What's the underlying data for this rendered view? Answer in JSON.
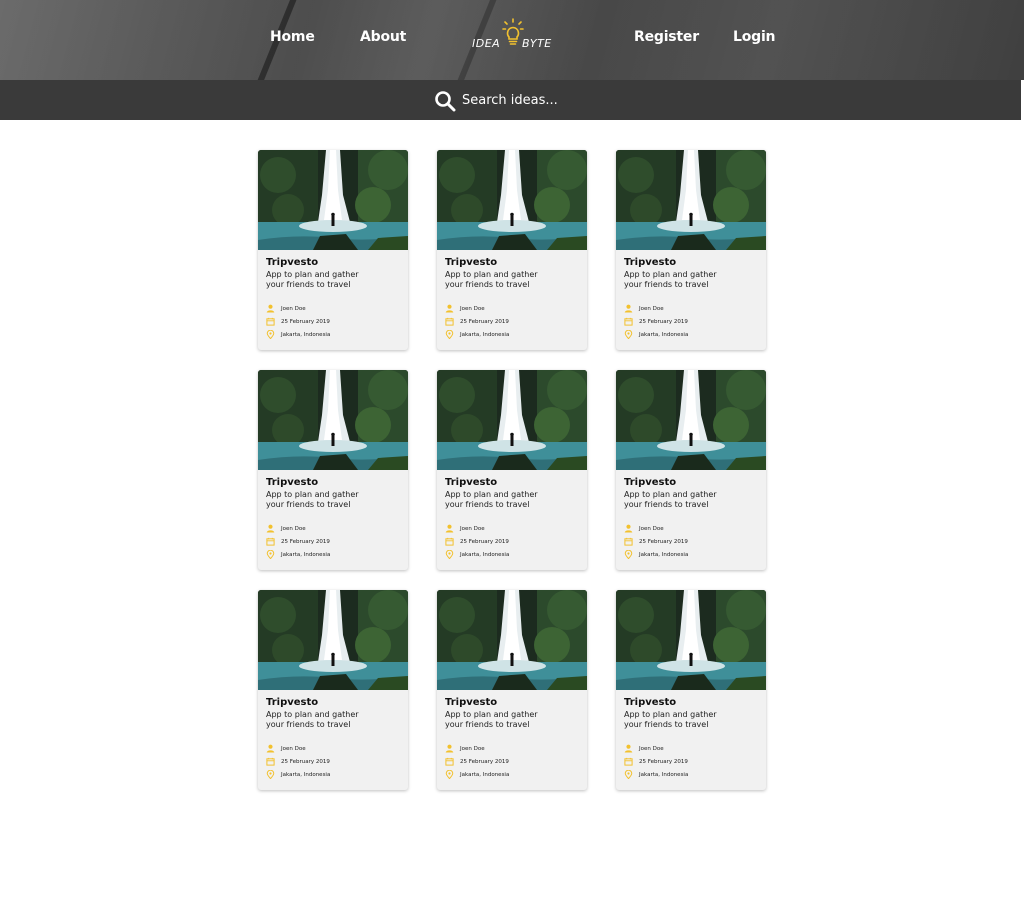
{
  "nav": {
    "home": "Home",
    "about": "About",
    "register": "Register",
    "login": "Login"
  },
  "logo": {
    "text_left": "IDEA",
    "text_right": "BYTE",
    "icon": "lightbulb-icon",
    "accent": "#f2c12e"
  },
  "search": {
    "placeholder": "Search ideas...",
    "icon": "search-icon"
  },
  "cards": [
    {
      "title": "Tripvesto",
      "desc_line1": "App to plan and gather",
      "desc_line2": "your friends to travel",
      "author": "Joen Doe",
      "date": "25 February 2019",
      "location": "Jakarta, Indonesia"
    },
    {
      "title": "Tripvesto",
      "desc_line1": "App to plan and gather",
      "desc_line2": "your friends to travel",
      "author": "Joen Doe",
      "date": "25 February 2019",
      "location": "Jakarta, Indonesia"
    },
    {
      "title": "Tripvesto",
      "desc_line1": "App to plan and gather",
      "desc_line2": "your friends to travel",
      "author": "Joen Doe",
      "date": "25 February 2019",
      "location": "Jakarta, Indonesia"
    },
    {
      "title": "Tripvesto",
      "desc_line1": "App to plan and gather",
      "desc_line2": "your friends to travel",
      "author": "Joen Doe",
      "date": "25 February 2019",
      "location": "Jakarta, Indonesia"
    },
    {
      "title": "Tripvesto",
      "desc_line1": "App to plan and gather",
      "desc_line2": "your friends to travel",
      "author": "Joen Doe",
      "date": "25 February 2019",
      "location": "Jakarta, Indonesia"
    },
    {
      "title": "Tripvesto",
      "desc_line1": "App to plan and gather",
      "desc_line2": "your friends to travel",
      "author": "Joen Doe",
      "date": "25 February 2019",
      "location": "Jakarta, Indonesia"
    },
    {
      "title": "Tripvesto",
      "desc_line1": "App to plan and gather",
      "desc_line2": "your friends to travel",
      "author": "Joen Doe",
      "date": "25 February 2019",
      "location": "Jakarta, Indonesia"
    },
    {
      "title": "Tripvesto",
      "desc_line1": "App to plan and gather",
      "desc_line2": "your friends to travel",
      "author": "Joen Doe",
      "date": "25 February 2019",
      "location": "Jakarta, Indonesia"
    },
    {
      "title": "Tripvesto",
      "desc_line1": "App to plan and gather",
      "desc_line2": "your friends to travel",
      "author": "Joen Doe",
      "date": "25 February 2019",
      "location": "Jakarta, Indonesia"
    }
  ],
  "card_icons": {
    "author": "user-icon",
    "date": "calendar-icon",
    "location": "location-pin-icon"
  },
  "colors": {
    "accent": "#f2c12e",
    "search_bar": "#3a3a3a",
    "card_bg": "#f1f1f1"
  }
}
